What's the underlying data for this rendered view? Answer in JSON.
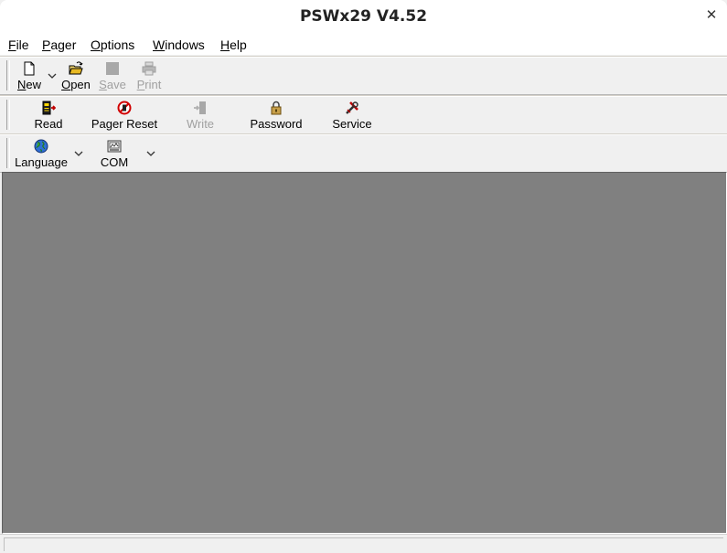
{
  "window": {
    "title": "PSWx29 V4.52"
  },
  "menu": {
    "file": {
      "acc": "F",
      "rest": "ile"
    },
    "pager": {
      "acc": "P",
      "rest": "ager"
    },
    "options": {
      "acc": "O",
      "rest": "ptions"
    },
    "windows": {
      "acc": "W",
      "rest": "indows"
    },
    "help": {
      "acc": "H",
      "rest": "elp"
    }
  },
  "toolbar1": {
    "new_acc": "N",
    "new_rest": "ew",
    "open_acc": "O",
    "open_rest": "pen",
    "save_acc": "S",
    "save_rest": "ave",
    "print_acc": "P",
    "print_rest": "rint"
  },
  "toolbar2": {
    "read": "Read",
    "pager_reset": "Pager Reset",
    "write": "Write",
    "password": "Password",
    "service": "Service"
  },
  "toolbar3": {
    "language": "Language",
    "com": "COM"
  },
  "statusbar": {
    "text": ""
  }
}
